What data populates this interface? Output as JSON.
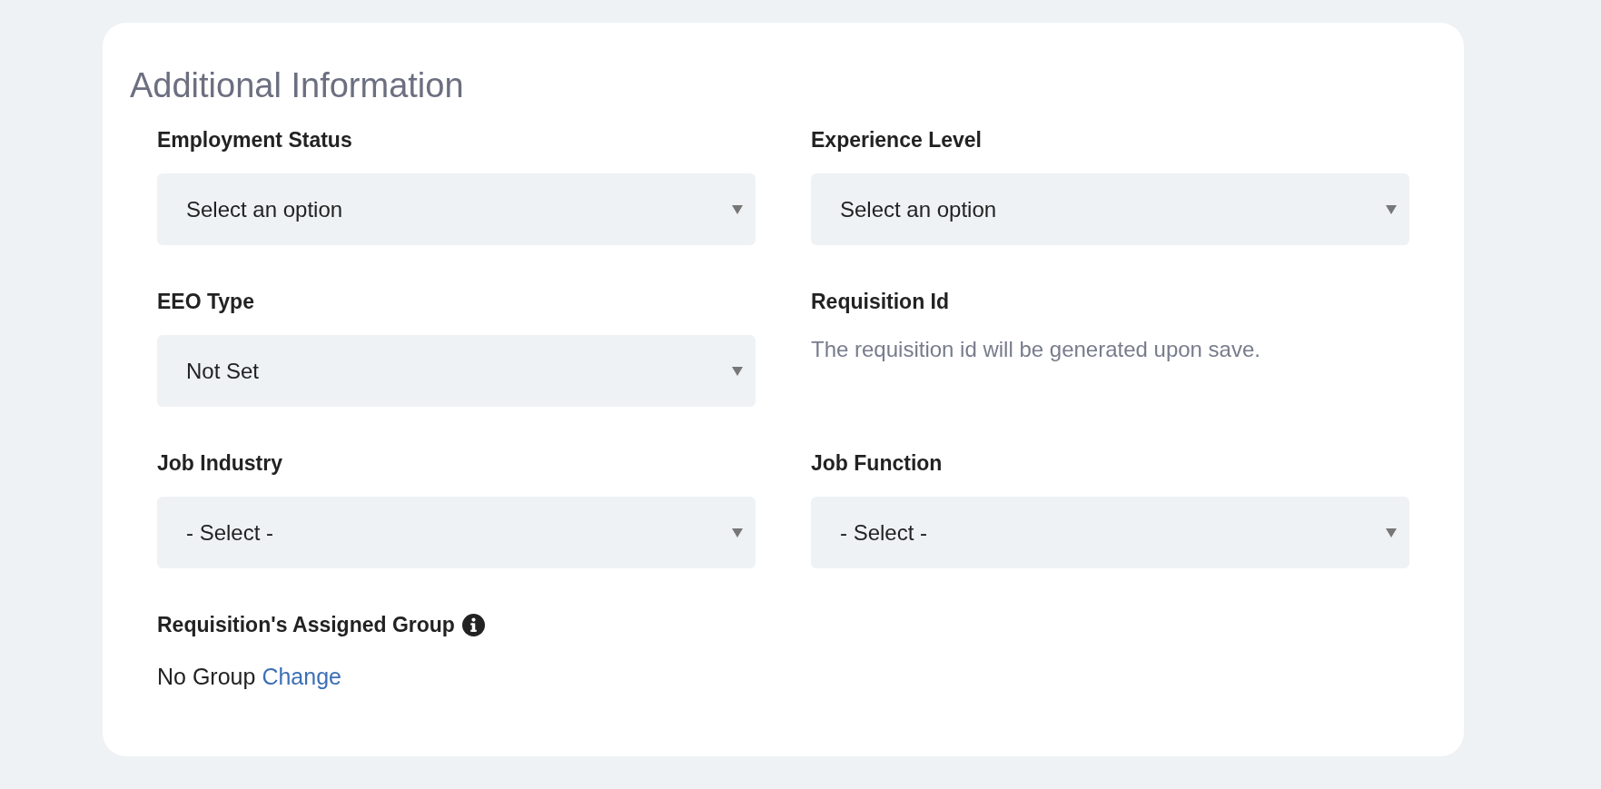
{
  "title": "Additional Information",
  "fields": [
    {
      "label": "Employment Status",
      "kind": "select",
      "value": "Select an option"
    },
    {
      "label": "Experience Level",
      "kind": "select",
      "value": "Select an option"
    },
    {
      "label": "EEO Type",
      "kind": "select",
      "value": "Not Set"
    },
    {
      "label": "Requisition Id",
      "kind": "note",
      "value": "The requisition id will be generated upon save."
    },
    {
      "label": "Job Industry",
      "kind": "select",
      "value": "- Select -"
    },
    {
      "label": "Job Function",
      "kind": "select",
      "value": "- Select -"
    }
  ],
  "group": {
    "label": "Requisition's Assigned Group",
    "value": "No Group",
    "link": "Change"
  }
}
